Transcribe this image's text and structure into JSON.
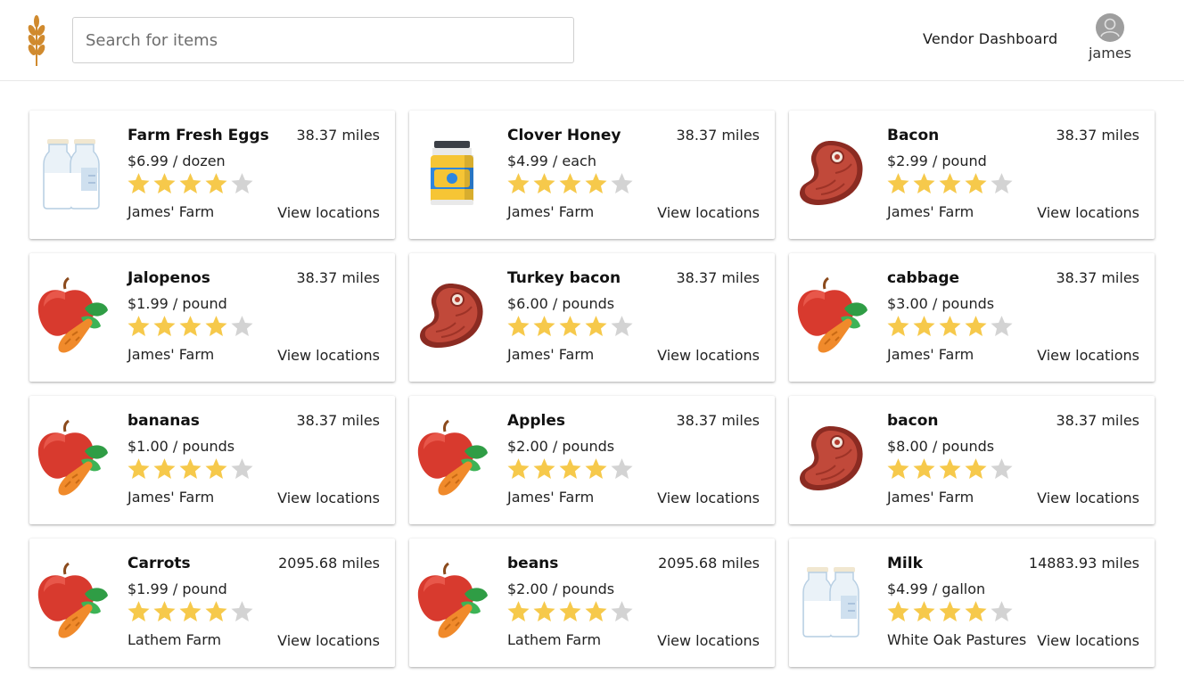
{
  "header": {
    "logo_icon": "wheat-icon",
    "search_placeholder": "Search for items",
    "vendor_dashboard": "Vendor Dashboard",
    "user_name": "james",
    "avatar_icon": "user-avatar-icon"
  },
  "colors": {
    "star_filled": "#F6C94B",
    "star_empty": "#D3D3D3",
    "logo": "#D08A2E"
  },
  "items": [
    {
      "title": "Farm Fresh Eggs",
      "distance": "38.37 miles",
      "price": "$6.99 / dozen",
      "rating": 4,
      "max_rating": 5,
      "farm": "James' Farm",
      "link": "View locations",
      "icon": "milk-bottles-icon"
    },
    {
      "title": "Clover Honey",
      "distance": "38.37 miles",
      "price": "$4.99 / each",
      "rating": 4,
      "max_rating": 5,
      "farm": "James' Farm",
      "link": "View locations",
      "icon": "honey-jar-icon"
    },
    {
      "title": "Bacon",
      "distance": "38.37 miles",
      "price": "$2.99 / pound",
      "rating": 4,
      "max_rating": 5,
      "farm": "James' Farm",
      "link": "View locations",
      "icon": "meat-steak-icon"
    },
    {
      "title": "Jalopenos",
      "distance": "38.37 miles",
      "price": "$1.99 / pound",
      "rating": 4,
      "max_rating": 5,
      "farm": "James' Farm",
      "link": "View locations",
      "icon": "apple-carrot-icon"
    },
    {
      "title": "Turkey bacon",
      "distance": "38.37 miles",
      "price": "$6.00 / pounds",
      "rating": 4,
      "max_rating": 5,
      "farm": "James' Farm",
      "link": "View locations",
      "icon": "meat-steak-icon"
    },
    {
      "title": "cabbage",
      "distance": "38.37 miles",
      "price": "$3.00 / pounds",
      "rating": 4,
      "max_rating": 5,
      "farm": "James' Farm",
      "link": "View locations",
      "icon": "apple-carrot-icon"
    },
    {
      "title": "bananas",
      "distance": "38.37 miles",
      "price": "$1.00 / pounds",
      "rating": 4,
      "max_rating": 5,
      "farm": "James' Farm",
      "link": "View locations",
      "icon": "apple-carrot-icon"
    },
    {
      "title": "Apples",
      "distance": "38.37 miles",
      "price": "$2.00 / pounds",
      "rating": 4,
      "max_rating": 5,
      "farm": "James' Farm",
      "link": "View locations",
      "icon": "apple-carrot-icon"
    },
    {
      "title": "bacon",
      "distance": "38.37 miles",
      "price": "$8.00 / pounds",
      "rating": 4,
      "max_rating": 5,
      "farm": "James' Farm",
      "link": "View locations",
      "icon": "meat-steak-icon"
    },
    {
      "title": "Carrots",
      "distance": "2095.68 miles",
      "price": "$1.99 / pound",
      "rating": 4,
      "max_rating": 5,
      "farm": "Lathem Farm",
      "link": "View locations",
      "icon": "apple-carrot-icon"
    },
    {
      "title": "beans",
      "distance": "2095.68 miles",
      "price": "$2.00 / pounds",
      "rating": 4,
      "max_rating": 5,
      "farm": "Lathem Farm",
      "link": "View locations",
      "icon": "apple-carrot-icon"
    },
    {
      "title": "Milk",
      "distance": "14883.93 miles",
      "price": "$4.99 / gallon",
      "rating": 4,
      "max_rating": 5,
      "farm": "White Oak Pastures",
      "link": "View locations",
      "icon": "milk-bottles-icon"
    }
  ]
}
